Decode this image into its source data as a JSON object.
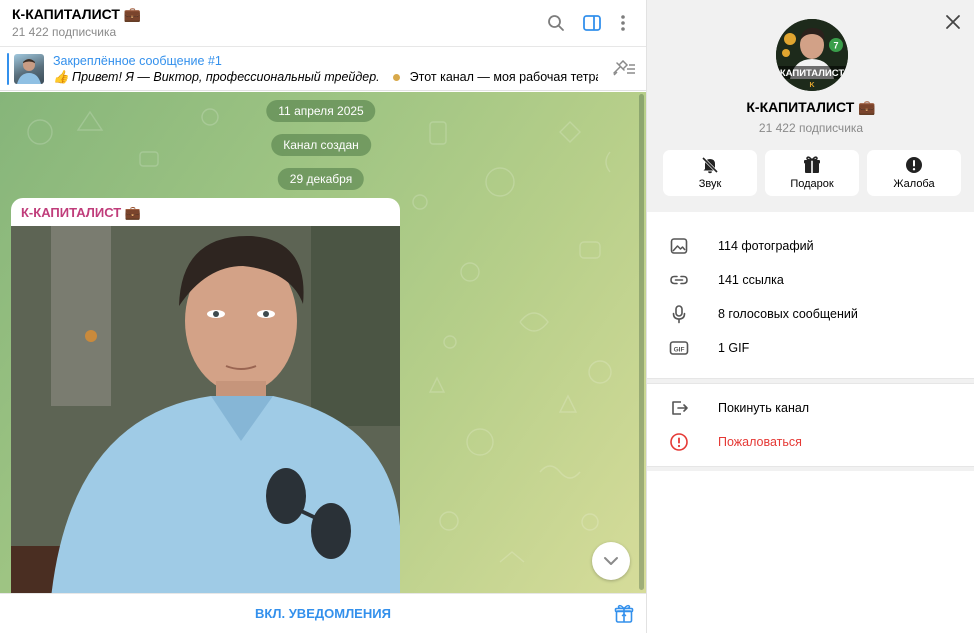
{
  "chat": {
    "title": "К-КАПИТАЛИСТ 💼",
    "subscribers": "21 422 подписчика",
    "pinned": {
      "title": "Закреплённое сообщение #1",
      "text_italic": "👍 Привет! Я — Виктор, профессиональный трейдер.",
      "text_rest": "Этот канал — моя рабочая тетрадь..."
    },
    "dates": [
      "11 апреля 2025",
      "Канал создан",
      "29 декабря"
    ],
    "post_author": "К-КАПИТАЛИСТ 💼",
    "footer_button": "ВКЛ. УВЕДОМЛЕНИЯ"
  },
  "profile": {
    "name": "К-КАПИТАЛИСТ 💼",
    "subscribers": "21 422 подписчика",
    "avatar_text": "КАПИТАЛИСТ",
    "avatar_badge": "7",
    "actions": [
      {
        "label": "Звук",
        "icon": "muted-bell-icon"
      },
      {
        "label": "Подарок",
        "icon": "gift-icon"
      },
      {
        "label": "Жалоба",
        "icon": "alert-icon"
      }
    ],
    "media": [
      {
        "label": "114 фотографий",
        "icon": "photo-icon"
      },
      {
        "label": "141 ссылка",
        "icon": "link-icon"
      },
      {
        "label": "8 голосовых сообщений",
        "icon": "microphone-icon"
      },
      {
        "label": "1 GIF",
        "icon": "gif-icon"
      }
    ],
    "leave": "Покинуть канал",
    "report": "Пожаловаться"
  },
  "colors": {
    "accent": "#3390ec",
    "author": "#c03d7b",
    "danger": "#e53935"
  }
}
